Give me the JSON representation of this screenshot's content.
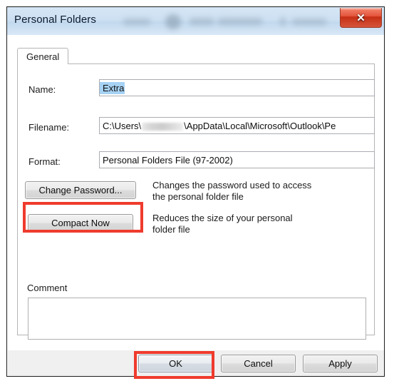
{
  "window": {
    "title": "Personal Folders",
    "close_label": "✕",
    "close_icon": "close-icon"
  },
  "tabs": [
    {
      "label": "General",
      "selected": true
    }
  ],
  "form": {
    "name": {
      "label": "Name:",
      "value": "Extra",
      "selected": true
    },
    "filename": {
      "label": "Filename:",
      "value_prefix": "C:\\Users\\",
      "redacted": true,
      "value_suffix": "\\AppData\\Local\\Microsoft\\Outlook\\Pe",
      "truncated": true
    },
    "format": {
      "label": "Format:",
      "value": "Personal Folders File (97-2002)"
    }
  },
  "actions": {
    "change_password": {
      "label": "Change Password...",
      "description_line1": "Changes the password used to access",
      "description_line2": "the personal folder file"
    },
    "compact_now": {
      "label": "Compact Now",
      "description_line1": "Reduces the size of your personal",
      "description_line2": "folder file",
      "highlighted": true
    }
  },
  "comment": {
    "label": "Comment",
    "value": "",
    "placeholder": ""
  },
  "footer": {
    "ok_label": "OK",
    "cancel_label": "Cancel",
    "apply_label": "Apply",
    "ok_highlighted": true
  },
  "annotations": {
    "highlight_color": "#ef3b2d",
    "count": 2,
    "targets": [
      "Compact Now",
      "OK"
    ]
  }
}
